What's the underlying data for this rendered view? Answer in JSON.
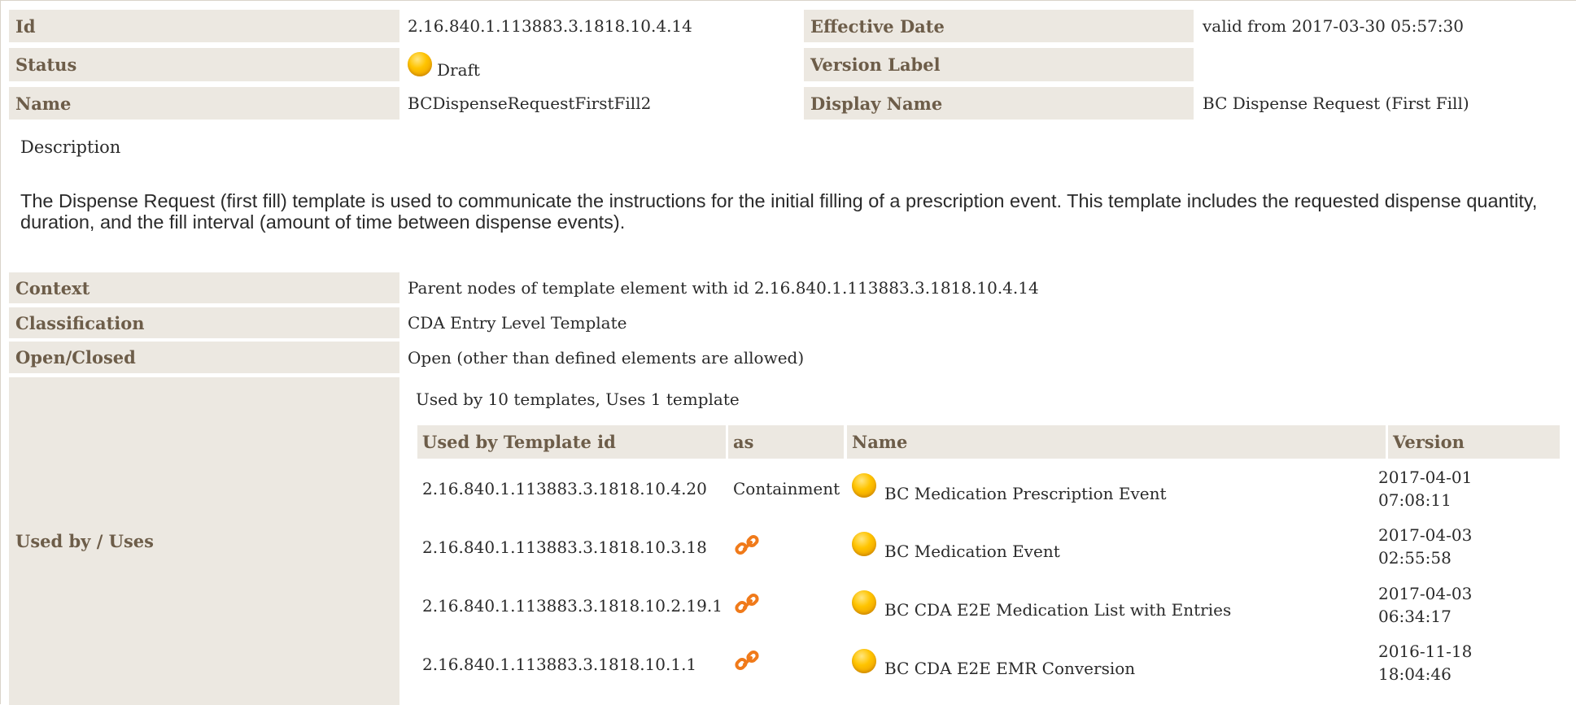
{
  "header_rows": [
    {
      "label": "Id",
      "value": "2.16.840.1.113883.3.1818.10.4.14",
      "label2": "Effective Date",
      "value2": "valid from 2017-03-30 05:57:30"
    },
    {
      "label": "Status",
      "value": "Draft",
      "label2": "Version Label",
      "value2": ""
    },
    {
      "label": "Name",
      "value": "BCDispenseRequestFirstFill2",
      "label2": "Display Name",
      "value2": "BC Dispense Request (First Fill)"
    }
  ],
  "status_icon": "status-draft-ball-icon",
  "description": {
    "label": "Description",
    "text": "The Dispense Request (first fill) template is used to communicate the instructions for the initial filling of a prescription event. This template includes the requested dispense quantity, duration, and the fill interval (amount of time between dispense events)."
  },
  "props": [
    {
      "label": "Context",
      "value": "Parent nodes of template element with id 2.16.840.1.113883.3.1818.10.4.14"
    },
    {
      "label": "Classification",
      "value": "CDA Entry Level Template"
    },
    {
      "label": "Open/Closed",
      "value": "Open (other than defined elements are allowed)"
    }
  ],
  "used_by": {
    "label": "Used by / Uses",
    "summary": "Used by 10 templates, Uses 1 template",
    "columns": [
      "Used by Template id",
      "as",
      "Name",
      "Version"
    ],
    "rows": [
      {
        "id": "2.16.840.1.113883.3.1818.10.4.20",
        "as": "Containment",
        "as_icon": "",
        "name": "BC Medication Prescription Event",
        "version_date": "2017-04-01",
        "version_time": "07:08:11"
      },
      {
        "id": "2.16.840.1.113883.3.1818.10.3.18",
        "as": "",
        "as_icon": "link-icon",
        "name": "BC Medication Event",
        "version_date": "2017-04-03",
        "version_time": "02:55:58"
      },
      {
        "id": "2.16.840.1.113883.3.1818.10.2.19.1",
        "as": "",
        "as_icon": "link-icon",
        "name": "BC CDA E2E Medication List with Entries",
        "version_date": "2017-04-03",
        "version_time": "06:34:17"
      },
      {
        "id": "2.16.840.1.113883.3.1818.10.1.1",
        "as": "",
        "as_icon": "link-icon",
        "name": "BC CDA E2E EMR Conversion",
        "version_date": "2016-11-18",
        "version_time": "18:04:46"
      }
    ]
  },
  "colors": {
    "label_bg": "#ece8e1",
    "label_text": "#6d5d49",
    "status_draft": "#ffc400",
    "link_icon": "#f07a1a"
  }
}
